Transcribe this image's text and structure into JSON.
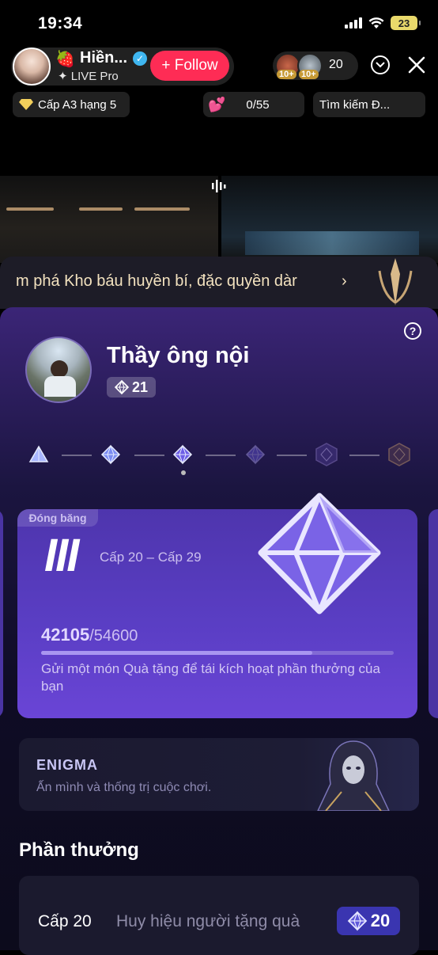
{
  "status_bar": {
    "time": "19:34",
    "battery": "23"
  },
  "host": {
    "name": "Hiền...",
    "subtitle": "LIVE Pro",
    "follow_label": "+ Follow"
  },
  "viewers": {
    "badge_1": "10+",
    "badge_2": "10+",
    "count": "20"
  },
  "chips": {
    "rank": "Cấp A3 hạng 5",
    "gift_progress": "0/55",
    "search": "Tìm kiếm Đ..."
  },
  "marquee": {
    "text": "m phá Kho báu huyền bí, đặc quyền dàr",
    "chevron": "›"
  },
  "profile": {
    "name": "Thầy ông nội",
    "level": "21"
  },
  "tier_card": {
    "tag": "Đóng băng",
    "numeral": "III",
    "range": "Cấp 20 – Cấp 29",
    "progress_current": "42105",
    "progress_max": "/54600",
    "progress_fraction": 0.77,
    "note": "Gửi một món Quà tặng để tái kích hoạt phần thưởng của bạn"
  },
  "enigma": {
    "title": "ENIGMA",
    "subtitle": "Ấn mình và thống trị cuộc chơi."
  },
  "rewards": {
    "title": "Phần thưởng",
    "items": [
      {
        "level": "Cấp 20",
        "name": "Huy hiệu người tặng quà",
        "badge_value": "20"
      }
    ]
  },
  "colors": {
    "follow": "#fe2c55",
    "card": "#5a3ec4",
    "accent_badge": "#3a35b0"
  }
}
